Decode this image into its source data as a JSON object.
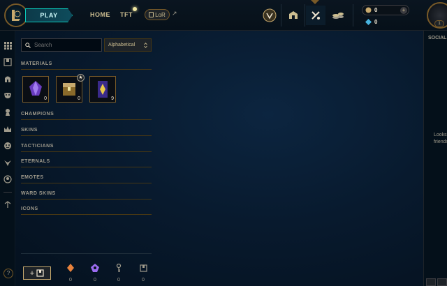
{
  "nav": {
    "play_label": "PLAY",
    "home_label": "HOME",
    "tft_label": "TFT",
    "lor_label": "LoR",
    "external_arrow": "↗"
  },
  "top_icons": [
    "honor-icon",
    "store-icon",
    "loot-icon",
    "currency-store-icon"
  ],
  "currency": {
    "be_value": "0",
    "rp_value": "0",
    "plus": "+"
  },
  "profile": {
    "level": "1"
  },
  "collection": {
    "search_placeholder": "Search",
    "sort_value": "Alphabetical",
    "sort_arrow": "⌃⌄",
    "sections": {
      "materials": "MATERIALS",
      "champions": "CHAMPIONS",
      "skins": "SKINS",
      "tacticians": "TACTICIANS",
      "eternals": "ETERNALS",
      "emotes": "EMOTES",
      "ward_skins": "WARD SKINS",
      "icons": "ICONS"
    },
    "materials": [
      {
        "name": "mythic-essence-icon",
        "count": "0"
      },
      {
        "name": "hextech-chest-icon",
        "count": "0",
        "star": "★"
      },
      {
        "name": "orb-capsule-icon",
        "count": "9"
      }
    ],
    "footer": {
      "add_label": "+",
      "essences": [
        {
          "name": "orange-essence-icon",
          "count": "0",
          "color": "#e8823c"
        },
        {
          "name": "blue-essence-icon",
          "count": "0",
          "color": "#9b6cf0"
        },
        {
          "name": "key-icon",
          "count": "0",
          "color": "#a09b8c"
        },
        {
          "name": "chest-icon",
          "count": "0",
          "color": "#a09b8c"
        }
      ]
    }
  },
  "left_rail": [
    "grid-icon",
    "chest-icon",
    "champion-helmet-icon",
    "mask-icon",
    "tactician-icon",
    "crown-icon",
    "emote-icon",
    "ward-icon",
    "profile-icon-icon",
    "back-arrow-icon"
  ],
  "help": "?",
  "social": {
    "title": "SOCIAL",
    "message_line1": "Looks",
    "message_line2": "friends"
  },
  "colors": {
    "gold": "#c8aa6e",
    "teal": "#0ac8b9",
    "background": "#081a2e"
  }
}
